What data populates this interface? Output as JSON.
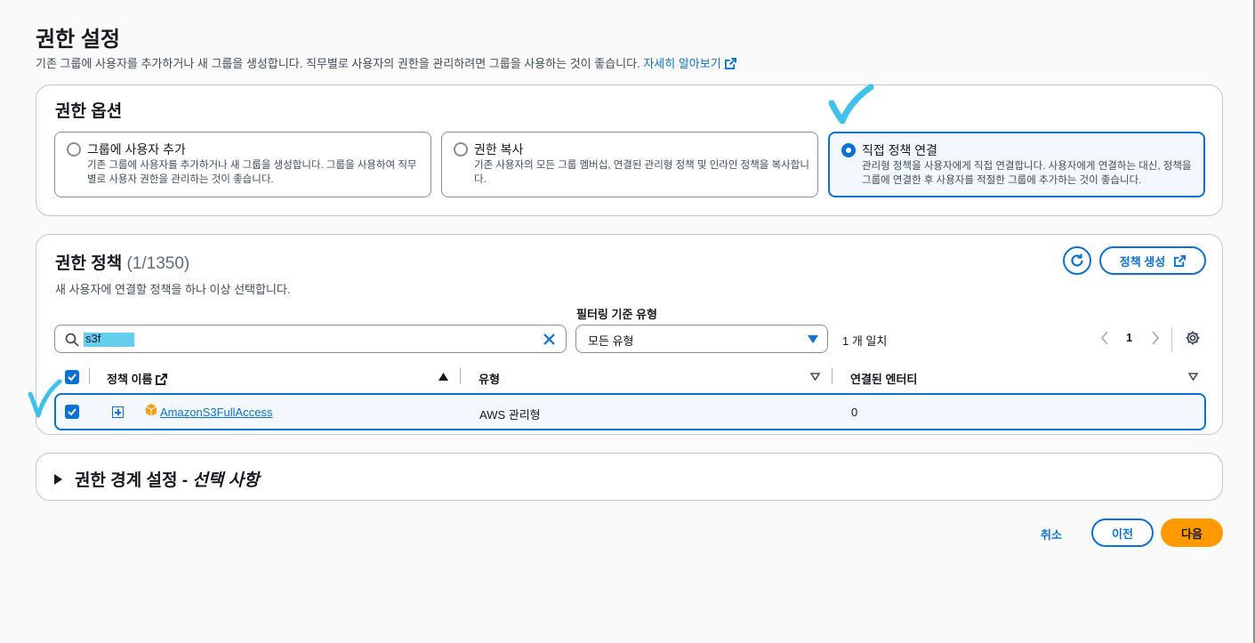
{
  "page": {
    "title": "권한 설정",
    "description": "기존 그룹에 사용자를 추가하거나 새 그룹을 생성합니다. 직무별로 사용자의 권한을 관리하려면 그룹을 사용하는 것이 좋습니다.",
    "learn_more": "자세히 알아보기"
  },
  "options": {
    "title": "권한 옵션",
    "tiles": [
      {
        "label": "그룹에 사용자 추가",
        "description": "기존 그룹에 사용자를 추가하거나 새 그룹을 생성합니다. 그룹을 사용하여 직무별로 사용자 권한을 관리하는 것이 좋습니다.",
        "selected": false
      },
      {
        "label": "권한 복사",
        "description": "기존 사용자의 모든 그룹 멤버십, 연결된 관리형 정책 및 인라인 정책을 복사합니다.",
        "selected": false
      },
      {
        "label": "직접 정책 연결",
        "description": "관리형 정책을 사용자에게 직접 연결합니다. 사용자에게 연결하는 대신, 정책을 그룹에 연결한 후 사용자를 적절한 그룹에 추가하는 것이 좋습니다.",
        "selected": true
      }
    ]
  },
  "policies": {
    "title": "권한 정책",
    "count": "(1/1350)",
    "description": "새 사용자에 연결할 정책을 하나 이상 선택합니다.",
    "create_button": "정책 생성",
    "filter_label": "필터링 기준 유형",
    "search_value": "s3f",
    "type_filter": "모든 유형",
    "match_text": "1 개 일치",
    "page_number": "1",
    "columns": [
      "정책 이름",
      "유형",
      "연결된 엔터티"
    ],
    "rows": [
      {
        "name": "AmazonS3FullAccess",
        "type": "AWS 관리형",
        "entities": "0",
        "checked": true
      }
    ]
  },
  "boundary": {
    "title": "권한 경계 설정 - ",
    "optional": "선택 사항"
  },
  "footer": {
    "cancel": "취소",
    "previous": "이전",
    "next": "다음"
  },
  "colors": {
    "accent": "#0972d3",
    "primary_button": "#ff9900",
    "annotation": "#3fc2ea"
  }
}
